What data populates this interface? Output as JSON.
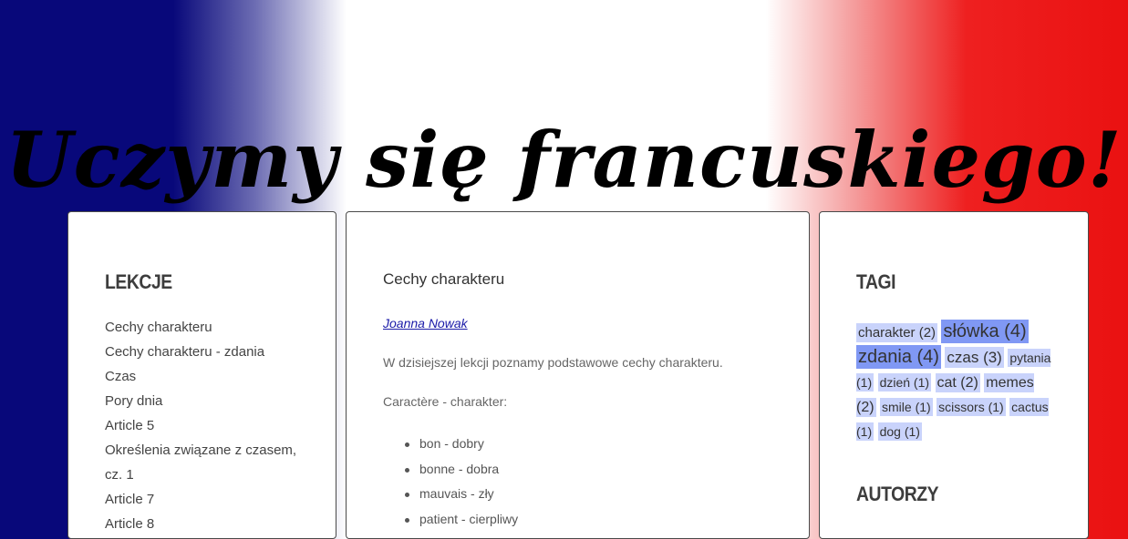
{
  "site": {
    "title": "Uczymy się francuskiego!"
  },
  "lessons": {
    "heading": "LEKCJE",
    "items": [
      "Cechy charakteru",
      "Cechy charakteru - zdania",
      "Czas",
      "Pory dnia",
      "Article 5",
      "Określenia związane z czasem, cz. 1",
      "Article 7",
      "Article 8"
    ]
  },
  "post": {
    "title": "Cechy charakteru",
    "author": "Joanna Nowak",
    "intro": "W dzisiejszej lekcji poznamy podstawowe cechy charakteru.",
    "subhead": "Caractère - charakter:",
    "vocab": [
      "bon - dobry",
      "bonne - dobra",
      "mauvais - zły",
      "patient - cierpliwy"
    ]
  },
  "tags": {
    "heading": "TAGI",
    "items": [
      {
        "label": "charakter (2)",
        "size": "small"
      },
      {
        "label": "słówka (4)",
        "size": "large"
      },
      {
        "label": "zdania (4)",
        "size": "large"
      },
      {
        "label": "czas (3)",
        "size": "medium"
      },
      {
        "label": "pytania (1)",
        "size": "small"
      },
      {
        "label": "dzień (1)",
        "size": "small"
      },
      {
        "label": "cat (2)",
        "size": "medium"
      },
      {
        "label": "memes (2)",
        "size": "medium"
      },
      {
        "label": "smile (1)",
        "size": "small"
      },
      {
        "label": "scissors (1)",
        "size": "small"
      },
      {
        "label": "cactus (1)",
        "size": "small"
      },
      {
        "label": "dog (1)",
        "size": "small"
      }
    ]
  },
  "authors": {
    "heading": "AUTORZY"
  },
  "colors": {
    "flag_blue": "#08087a",
    "flag_white": "#ffffff",
    "flag_red": "#ea1111",
    "tag_bg": "#c9d3fb",
    "tag_bg_strong": "#8098f4",
    "link": "#1a1aa8"
  }
}
